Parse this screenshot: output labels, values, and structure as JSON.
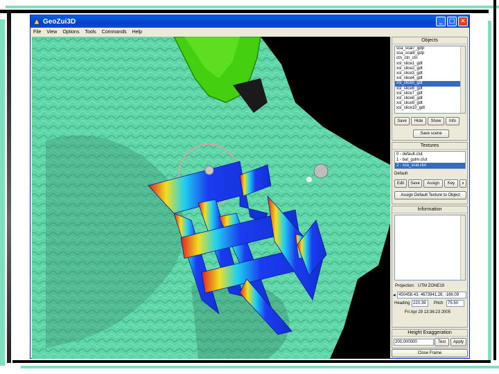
{
  "window": {
    "title": "GeoZui3D"
  },
  "titlebar_buttons": {
    "minimize": "_",
    "maximize": "□",
    "close": "✕"
  },
  "menu": [
    "File",
    "View",
    "Options",
    "Tools",
    "Commands",
    "Help"
  ],
  "objects": {
    "title": "Objects",
    "items": [
      "sca_scal7_gdp",
      "sca_scal8_gdp",
      "ctn_ctn_ctn",
      "xsl_slice1_gdt",
      "xsl_slice2_gdt",
      "xsl_slice3_gdt",
      "xsl_slice4_gdt",
      "xsl_slice5_gdt",
      "xsl_slice6_gdt",
      "xsl_slice7_gdt",
      "xsl_slice8_gdt",
      "xsl_slice9_gdt",
      "xsl_slice10_gdt"
    ],
    "selected_index": 7,
    "buttons": {
      "save": "Save",
      "hide": "Hide",
      "show": "Show",
      "info": "Info"
    },
    "save_scene": "Save scene"
  },
  "textures": {
    "title": "Textures",
    "items": [
      "0 - default.clut",
      "1 - bat_gulm.clut",
      "2 - sca_scal.clut"
    ],
    "selected_index": 2,
    "default_label": "Default",
    "buttons": {
      "edit": "Edit",
      "save": "Save",
      "assign": "Assign",
      "key": "Key",
      "x": "x"
    },
    "assign_default": "Assign Default Texture to Object"
  },
  "information": {
    "title": "Information",
    "projection_label": "Projection:",
    "projection_value": "UTM ZONE19",
    "coords": "450458.43, 4673941.28, -166.09",
    "heading_label": "Heading",
    "heading_value": "220.39",
    "pitch_label": "Pitch",
    "pitch_value": "75.50",
    "timestamp": "Fri Apr 29 13:36:23 2005"
  },
  "height": {
    "title": "Height Exaggeration",
    "value": "200.000000",
    "test": "Test",
    "apply": "Apply"
  },
  "close_frame": "Close Frame",
  "colors": {
    "terrain": "#5fd6a8",
    "island": "#44d010",
    "slices": "#1a3cf0",
    "title_bar": "#0a4bd4",
    "selection": "#316ac5"
  }
}
